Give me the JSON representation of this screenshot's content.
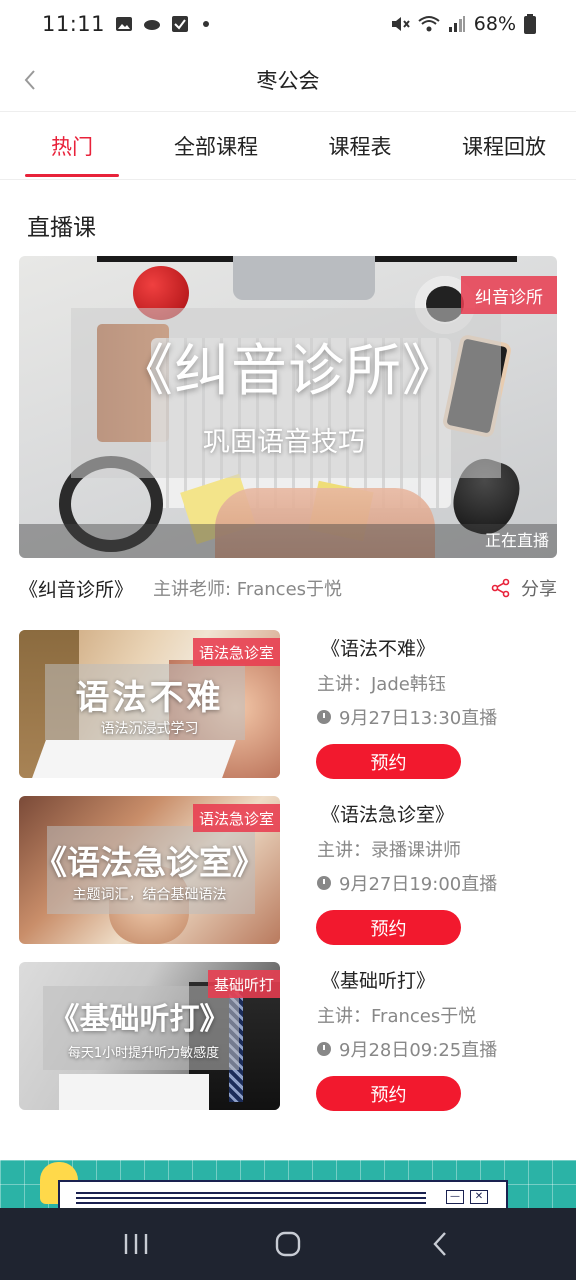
{
  "statusbar": {
    "time": "11:11",
    "battery": "68%"
  },
  "header": {
    "title": "枣公会"
  },
  "tabs": [
    {
      "label": "热门",
      "active": true
    },
    {
      "label": "全部课程",
      "active": false
    },
    {
      "label": "课程表",
      "active": false
    },
    {
      "label": "课程回放",
      "active": false
    }
  ],
  "section": {
    "title": "直播课"
  },
  "banner": {
    "big_title": "《纠音诊所》",
    "subtitle": "巩固语音技巧",
    "tag": "纠音诊所",
    "status": "正在直播"
  },
  "live_info": {
    "course_name": "《纠音诊所》",
    "teacher": "主讲老师: Frances于悦",
    "share_label": "分享"
  },
  "courses": [
    {
      "thumb_title": "语法不难",
      "thumb_sub": "语法沉浸式学习",
      "thumb_tag": "语法急诊室",
      "title": "《语法不难》",
      "teacher": "主讲：Jade韩钰",
      "time": "9月27日13:30直播",
      "button": "预约"
    },
    {
      "thumb_title": "《语法急诊室》",
      "thumb_sub": "主题词汇，结合基础语法",
      "thumb_tag": "语法急诊室",
      "title": "《语法急诊室》",
      "teacher": "主讲：录播课讲师",
      "time": "9月27日19:00直播",
      "button": "预约"
    },
    {
      "thumb_title": "《基础听打》",
      "thumb_sub": "每天1小时提升听力敏感度",
      "thumb_tag": "基础听打",
      "title": "《基础听打》",
      "teacher": "主讲：Frances于悦",
      "time": "9月28日09:25直播",
      "button": "预约"
    }
  ],
  "colors": {
    "accent": "#e8223a",
    "button": "#f2192e",
    "navbar": "#1f2430"
  },
  "icons": [
    "back-chevron-icon",
    "share-icon",
    "clock-icon",
    "recents-icon",
    "home-icon",
    "back-icon"
  ]
}
